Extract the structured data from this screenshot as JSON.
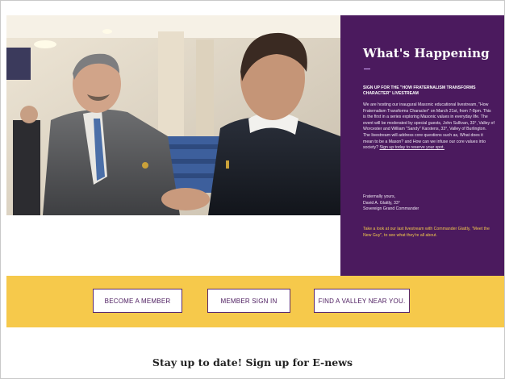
{
  "news": {
    "heading": "What's Happening",
    "subhead": "SIGN UP FOR THE \"HOW FRATERNALISM TRANSFORMS CHARACTER\" LIVESTREAM",
    "body": "We are hosting our inaugural Masonic educational livestream, \"How Fraternalism Transforms Character\" on March 21st, from 7-8pm. This is the first in a series exploring Masonic values in everyday life. The event will be moderated by special guests, John Sullivan, 33°, Valley of Worcester and William \"Sandy\" Karstens, 33°, Valley of Burlington. The livestream will address core questions such as, What does it mean to be a Mason? and How can we infuse our core values into society?",
    "link_text": "Sign up today to reserve your spot.",
    "closing_line1": "Fraternally yours,",
    "closing_line2": "David A. Glattly, 33°",
    "closing_line3": "Sovereign Grand Commander",
    "note": "Take a look at our last livestream with Commander Glattly, \"Meet the New Guy\", to see what they're all about."
  },
  "cta": {
    "become_member": "BECOME A MEMBER",
    "member_sign_in": "MEMBER SIGN IN",
    "find_valley": "FIND A VALLEY NEAR YOU."
  },
  "enews": {
    "title": "Stay up to date! Sign up for E-news"
  },
  "colors": {
    "panel_purple": "#4b1a5e",
    "cta_yellow": "#f6c94b",
    "note_gold": "#f2c94c"
  }
}
